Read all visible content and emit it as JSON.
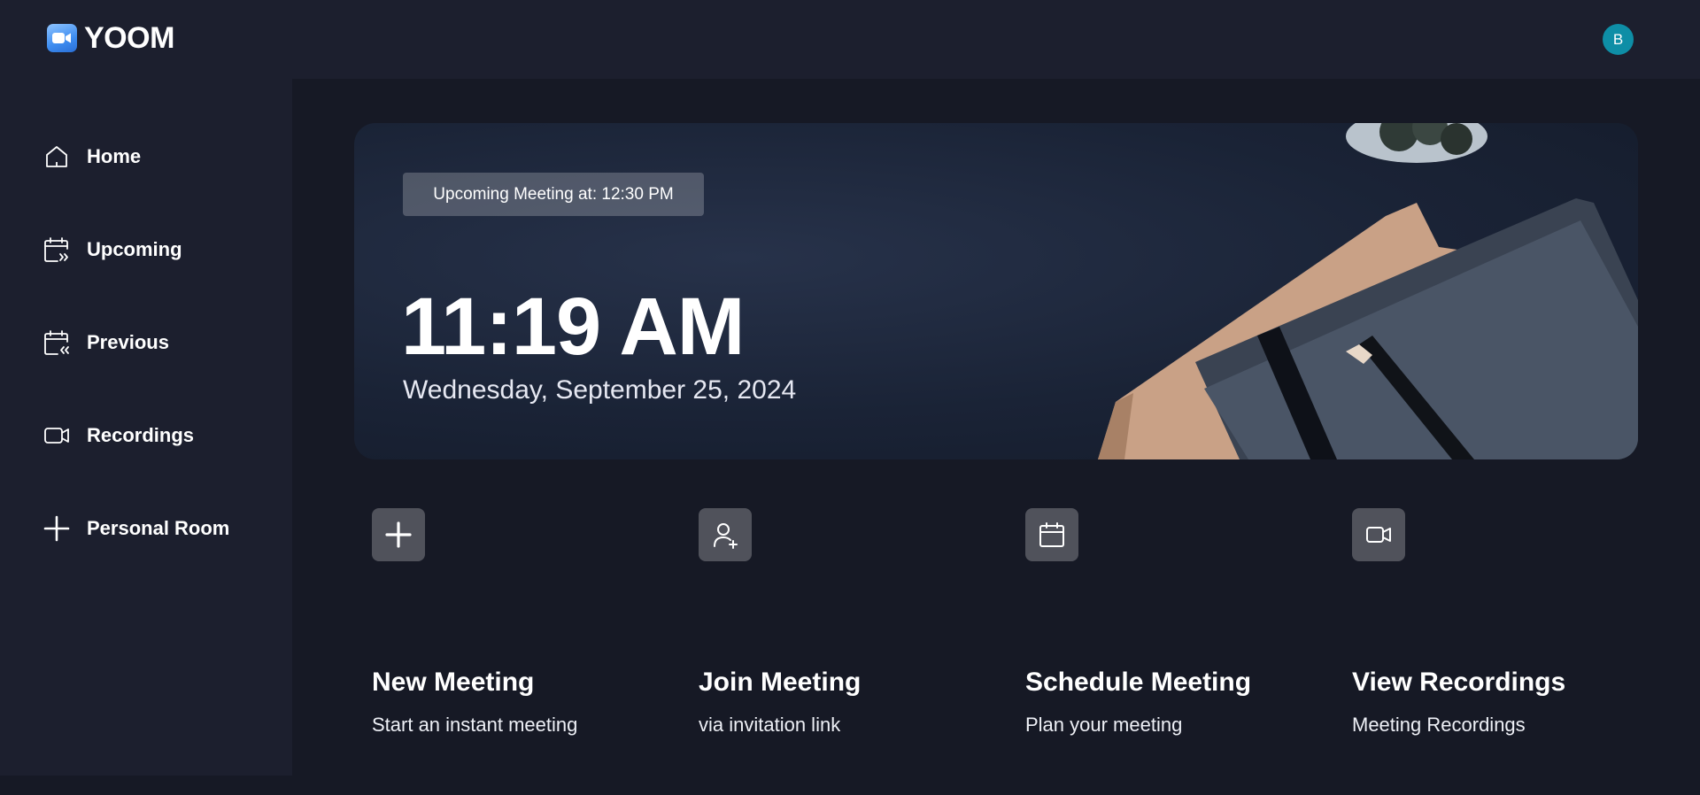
{
  "app": {
    "name": "YOOM",
    "avatar_initial": "B"
  },
  "sidebar": {
    "items": [
      {
        "label": "Home",
        "icon": "home-icon"
      },
      {
        "label": "Upcoming",
        "icon": "calendar-forward-icon"
      },
      {
        "label": "Previous",
        "icon": "calendar-back-icon"
      },
      {
        "label": "Recordings",
        "icon": "video-icon"
      },
      {
        "label": "Personal Room",
        "icon": "plus-icon"
      }
    ]
  },
  "hero": {
    "upcoming_label": "Upcoming Meeting at: 12:30 PM",
    "time": "11:19 AM",
    "date": "Wednesday, September 25, 2024"
  },
  "actions": [
    {
      "title": "New Meeting",
      "subtitle": "Start an instant meeting",
      "icon": "plus-icon"
    },
    {
      "title": "Join Meeting",
      "subtitle": "via invitation link",
      "icon": "user-plus-icon"
    },
    {
      "title": "Schedule Meeting",
      "subtitle": "Plan your meeting",
      "icon": "calendar-icon"
    },
    {
      "title": "View Recordings",
      "subtitle": "Meeting Recordings",
      "icon": "video-icon"
    }
  ],
  "colors": {
    "background": "#161925",
    "panel": "#1c1f2e",
    "avatar": "#0e8ea6",
    "text": "#ffffff"
  }
}
